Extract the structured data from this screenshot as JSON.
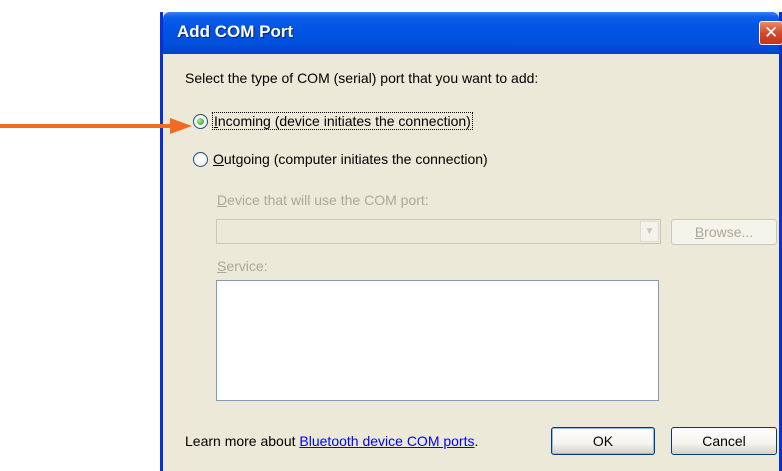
{
  "dialog": {
    "title": "Add COM Port",
    "close_glyph": "✕",
    "prompt": "Select the type of COM (serial) port that you want to add:",
    "options": [
      {
        "hotkey": "I",
        "rest": "ncoming (device initiates the connection)",
        "selected": true
      },
      {
        "hotkey": "O",
        "rest": "utgoing (computer initiates the connection)",
        "selected": false
      }
    ],
    "device": {
      "label_prefix": "D",
      "label_rest": "evice that will use the COM port:",
      "value": "",
      "browse_prefix": "B",
      "browse_rest": "rowse..."
    },
    "service": {
      "label_prefix": "S",
      "label_rest": "ervice:",
      "value": ""
    },
    "footer": {
      "text": "Learn more about ",
      "link": "Bluetooth device COM ports",
      "suffix": "."
    },
    "buttons": {
      "ok": "OK",
      "cancel": "Cancel"
    }
  },
  "annotation": {
    "color": "#f26b21",
    "icon": "arrow-right-icon"
  },
  "colors": {
    "title_bar": "#0054e3",
    "dialog_bg": "#ece9d8",
    "disabled_text": "#aca899"
  }
}
